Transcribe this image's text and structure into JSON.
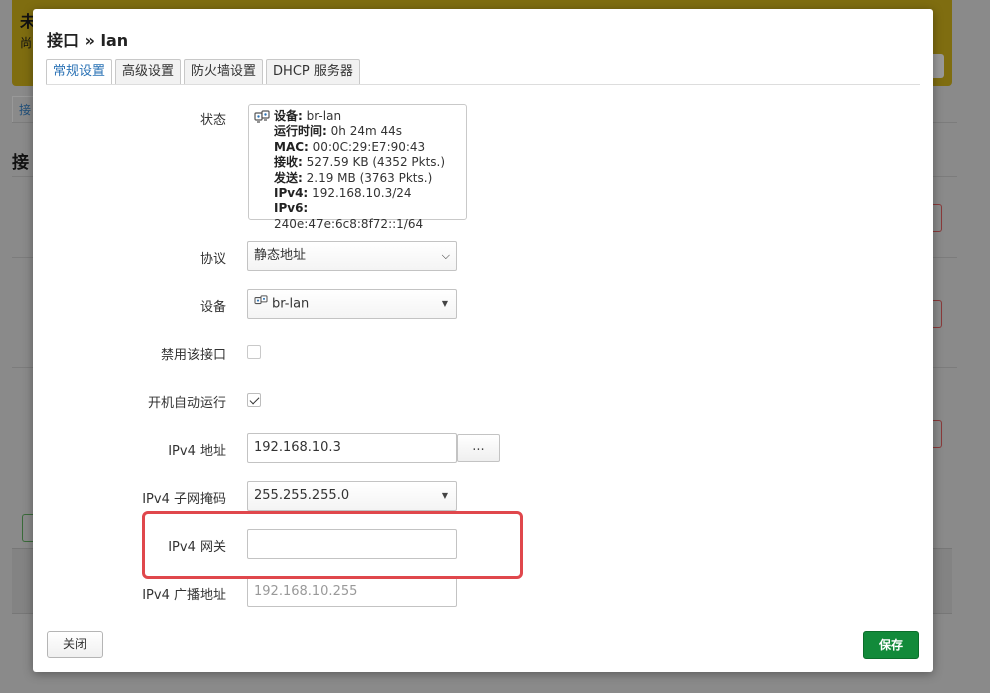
{
  "background": {
    "banner_title": "未",
    "banner_sub": "尚",
    "tab_label": "接",
    "section_head": "接"
  },
  "modal": {
    "title": "接口 » lan",
    "tabs": [
      {
        "label": "常规设置",
        "active": true
      },
      {
        "label": "高级设置",
        "active": false
      },
      {
        "label": "防火墙设置",
        "active": false
      },
      {
        "label": "DHCP 服务器",
        "active": false
      }
    ]
  },
  "form": {
    "status_label": "状态",
    "status": {
      "device_key": "设备:",
      "device_val": "br-lan",
      "uptime_key": "运行时间:",
      "uptime_val": "0h 24m 44s",
      "mac_key": "MAC:",
      "mac_val": "00:0C:29:E7:90:43",
      "rx_key": "接收:",
      "rx_val": "527.59 KB (4352 Pkts.)",
      "tx_key": "发送:",
      "tx_val": "2.19 MB (3763 Pkts.)",
      "ipv4_key": "IPv4:",
      "ipv4_val": "192.168.10.3/24",
      "ipv6_key": "IPv6:",
      "ipv6_val": "240e:47e:6c8:8f72::1/64"
    },
    "protocol_label": "协议",
    "protocol_value": "静态地址",
    "device_label": "设备",
    "device_value": "br-lan",
    "disable_label": "禁用该接口",
    "disable_checked": false,
    "autostart_label": "开机自动运行",
    "autostart_checked": true,
    "ipv4_addr_label": "IPv4 地址",
    "ipv4_addr_value": "192.168.10.3",
    "ipv4_addr_more": "...",
    "netmask_label": "IPv4 子网掩码",
    "netmask_value": "255.255.255.0",
    "gateway_label": "IPv4 网关",
    "gateway_value": "",
    "broadcast_label": "IPv4 广播地址",
    "broadcast_placeholder": "192.168.10.255"
  },
  "buttons": {
    "close": "关闭",
    "save": "保存"
  },
  "colors": {
    "accent_tab": "#2a72b5",
    "save_green": "#128a3a",
    "highlight_red": "#e0474c",
    "banner_yellow": "#7f6d10"
  }
}
